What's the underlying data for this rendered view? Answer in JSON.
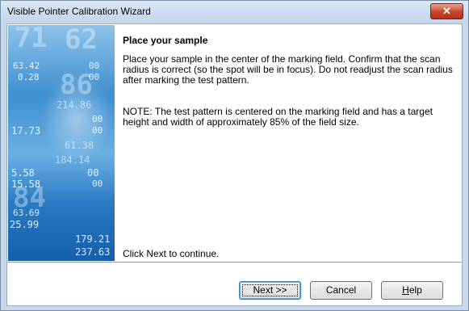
{
  "window": {
    "title": "Visible Pointer Calibration Wizard",
    "close_glyph": "✕"
  },
  "side_image": {
    "numbers": [
      "71",
      "62",
      "63.42",
      "00",
      "0.28",
      "00",
      "86",
      "214.86",
      "00",
      "17.73",
      "00",
      "61.38",
      "184.14",
      "5.58",
      "15.58",
      "00",
      "00",
      "84",
      "63.69",
      "25.99",
      "179.21",
      "237.63"
    ]
  },
  "page": {
    "heading": "Place your sample",
    "paragraph1": "Place your sample in the center of the marking field. Confirm that the scan radius is correct (so the spot will be in focus). Do not readjust the scan radius after marking the test pattern.",
    "paragraph2": "NOTE: The test pattern is centered on the marking field and has a target height and width of approximately 85% of the field size.",
    "continue_hint": "Click Next to continue."
  },
  "buttons": {
    "next": "Next >>",
    "cancel": "Cancel",
    "help_prefix": "",
    "help_underlined": "H",
    "help_rest": "elp"
  }
}
